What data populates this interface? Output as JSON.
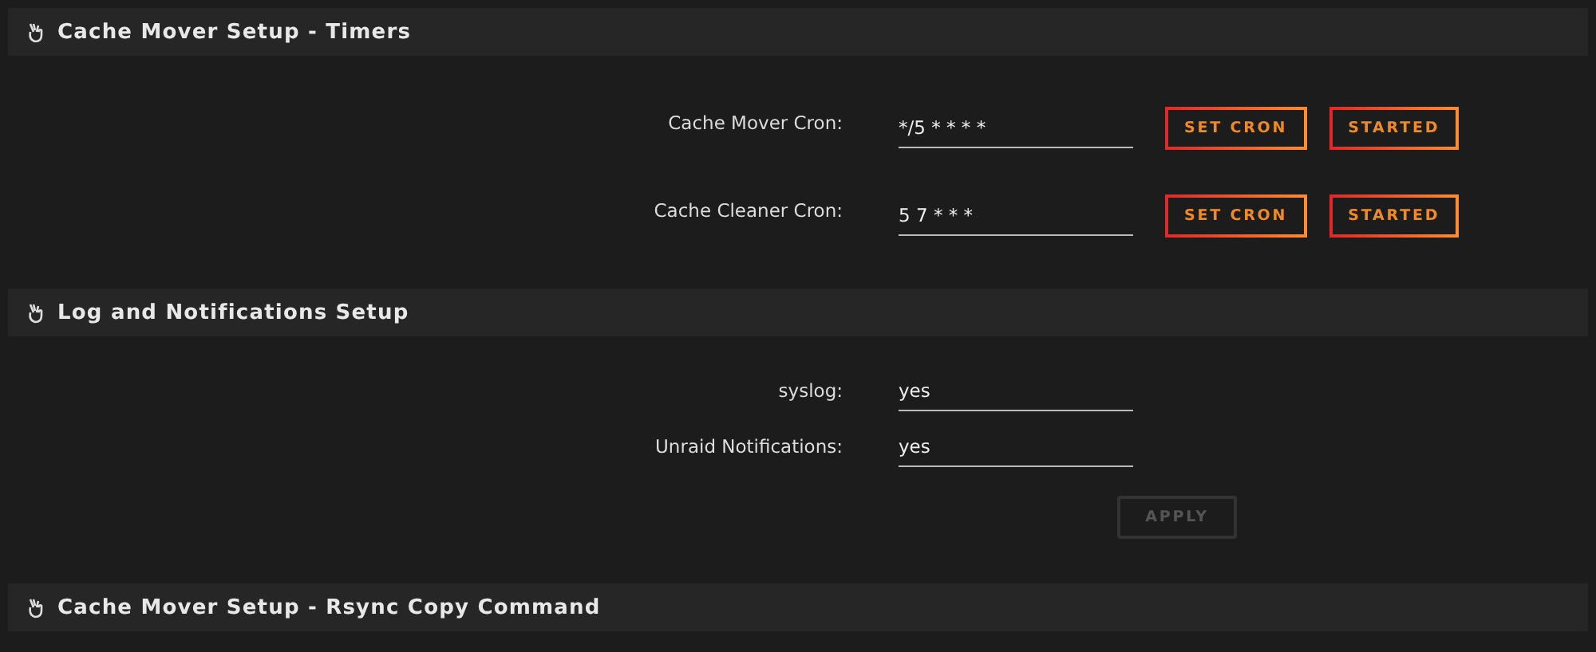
{
  "sections": [
    {
      "title": "Cache Mover Setup - Timers",
      "rows": [
        {
          "kind": "cron",
          "label": "Cache Mover Cron:",
          "value": "*/5 * * * *",
          "buttons": [
            {
              "label": "SET CRON",
              "disabled": false
            },
            {
              "label": "STARTED",
              "disabled": false
            }
          ]
        },
        {
          "kind": "cron",
          "label": "Cache Cleaner Cron:",
          "value": "5 7 * * *",
          "buttons": [
            {
              "label": "SET CRON",
              "disabled": false
            },
            {
              "label": "STARTED",
              "disabled": false
            }
          ]
        }
      ]
    },
    {
      "title": "Log and Notifications Setup",
      "rows": [
        {
          "kind": "select",
          "label": "syslog:",
          "value": "yes"
        },
        {
          "kind": "select",
          "label": "Unraid Notifications:",
          "value": "yes"
        }
      ],
      "apply": {
        "label": "APPLY",
        "disabled": true
      }
    },
    {
      "title": "Cache Mover Setup - Rsync Copy Command"
    }
  ]
}
